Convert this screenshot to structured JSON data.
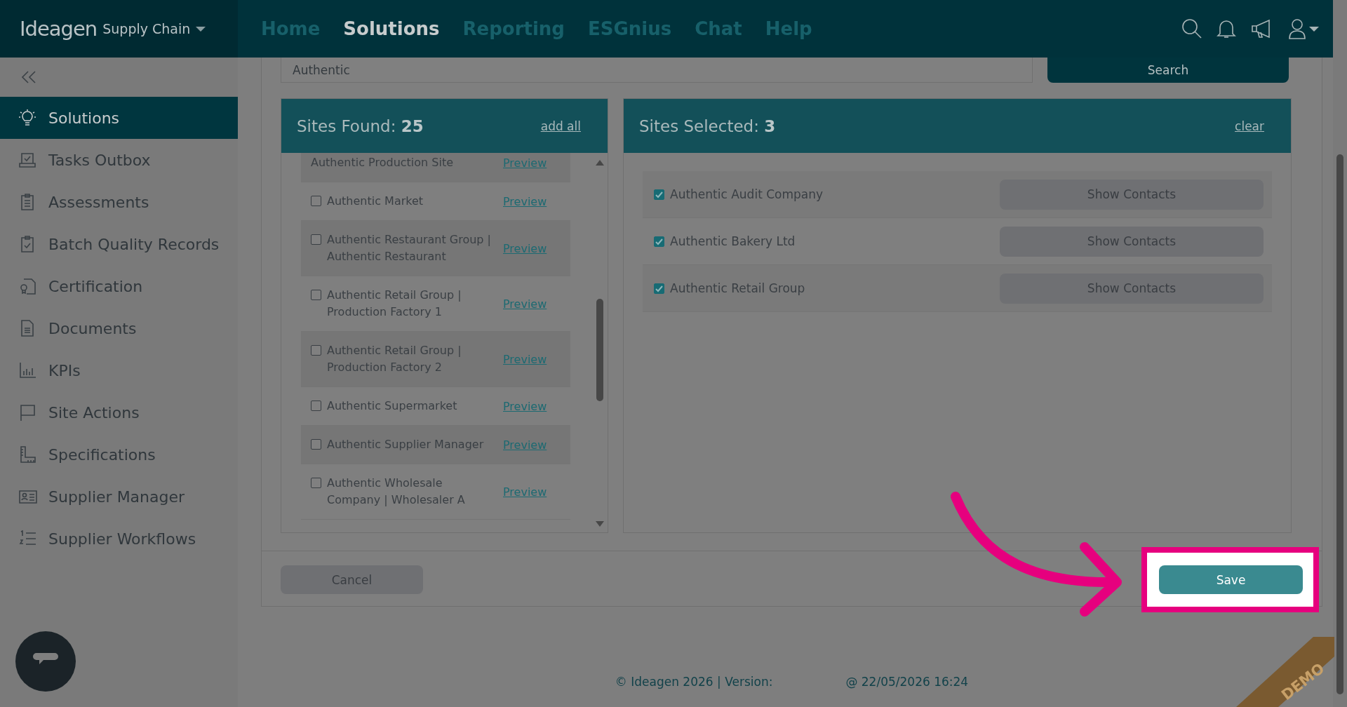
{
  "header": {
    "brand": "Ideagen",
    "product": "Supply Chain",
    "nav": [
      {
        "label": "Home",
        "selected": false
      },
      {
        "label": "Solutions",
        "selected": true
      },
      {
        "label": "Reporting",
        "selected": false
      },
      {
        "label": "ESGnius",
        "selected": false
      },
      {
        "label": "Chat",
        "selected": false
      },
      {
        "label": "Help",
        "selected": false
      }
    ]
  },
  "sidebar": {
    "items": [
      {
        "label": "Solutions",
        "selected": true
      },
      {
        "label": "Tasks Outbox",
        "selected": false
      },
      {
        "label": "Assessments",
        "selected": false
      },
      {
        "label": "Batch Quality Records",
        "selected": false
      },
      {
        "label": "Certification",
        "selected": false
      },
      {
        "label": "Documents",
        "selected": false
      },
      {
        "label": "KPIs",
        "selected": false
      },
      {
        "label": "Site Actions",
        "selected": false
      },
      {
        "label": "Specifications",
        "selected": false
      },
      {
        "label": "Supplier Manager",
        "selected": false
      },
      {
        "label": "Supplier Workflows",
        "selected": false
      }
    ]
  },
  "search": {
    "value": "Authentic",
    "button": "Search"
  },
  "sites_found": {
    "title": "Sites Found:",
    "count": "25",
    "action": "add all",
    "items": [
      {
        "kind": "clipped",
        "name": "Authentic Production Site",
        "link": "Preview"
      },
      {
        "kind": "site",
        "name": "Authentic Market",
        "checked": false,
        "link": "Preview"
      },
      {
        "kind": "site",
        "name": "Authentic Restaurant Group | Authentic Restaurant",
        "checked": false,
        "link": "Preview"
      },
      {
        "kind": "site",
        "name": "Authentic Retail Group | Production Factory 1",
        "checked": false,
        "link": "Preview"
      },
      {
        "kind": "site",
        "name": "Authentic Retail Group | Production Factory 2",
        "checked": false,
        "link": "Preview"
      },
      {
        "kind": "site",
        "name": "Authentic Supermarket",
        "checked": false,
        "link": "Preview"
      },
      {
        "kind": "site",
        "name": "Authentic Supplier Manager",
        "checked": false,
        "link": "Preview"
      },
      {
        "kind": "site",
        "name": "Authentic Wholesale Company | Wholesaler A",
        "checked": false,
        "link": "Preview"
      }
    ]
  },
  "sites_selected": {
    "title": "Sites Selected:",
    "count": "3",
    "action": "clear",
    "items": [
      {
        "name": "Authentic Audit Company",
        "checked": true,
        "button": "Show Contacts"
      },
      {
        "name": "Authentic Bakery Ltd",
        "checked": true,
        "button": "Show Contacts"
      },
      {
        "name": "Authentic Retail Group",
        "checked": true,
        "button": "Show Contacts"
      }
    ]
  },
  "buttons": {
    "cancel": "Cancel",
    "save": "Save"
  },
  "footer": {
    "copyright": "© Ideagen 2026 | Version:",
    "timestamp": "@ 22/05/2026 16:24"
  },
  "demo_ribbon": "DEMO"
}
